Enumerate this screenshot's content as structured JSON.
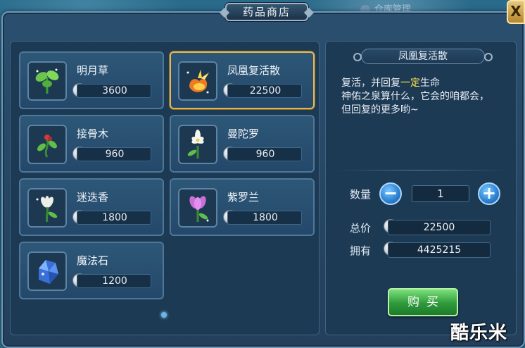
{
  "window": {
    "title": "药品商店",
    "close_label": "X"
  },
  "background": {
    "top_label": "仓库管理"
  },
  "items": [
    {
      "name": "明月草",
      "price": "3600",
      "icon": "clover-plant-icon"
    },
    {
      "name": "凤凰复活散",
      "price": "22500",
      "icon": "phoenix-elixir-icon",
      "selected": true
    },
    {
      "name": "接骨木",
      "price": "960",
      "icon": "berry-vine-icon"
    },
    {
      "name": "曼陀罗",
      "price": "960",
      "icon": "white-lily-icon"
    },
    {
      "name": "迷迭香",
      "price": "1800",
      "icon": "rosemary-flower-icon"
    },
    {
      "name": "紫罗兰",
      "price": "1800",
      "icon": "violet-tulip-icon"
    },
    {
      "name": "魔法石",
      "price": "1200",
      "icon": "magic-crystal-icon"
    }
  ],
  "detail": {
    "title": "凤凰复活散",
    "desc_line1_pre": "复活，并回复",
    "desc_line1_hl": "一定",
    "desc_line1_post": "生命",
    "desc_line2": "神佑之泉算什么，它会的咱都会，",
    "desc_line3": "但回复的更多哟~",
    "quantity_label": "数量",
    "quantity": "1",
    "minus_label": "−",
    "plus_label": "+",
    "total_label": "总价",
    "total": "22500",
    "owned_label": "拥有",
    "owned": "4425215",
    "buy_label": "购买"
  },
  "currency_symbol": "S",
  "watermark": "酷乐米",
  "colors": {
    "selected_border": "#e0b85a",
    "highlight_text": "#ffe64a",
    "buy_button": "#2f9a3c",
    "round_button": "#2f86d6"
  }
}
